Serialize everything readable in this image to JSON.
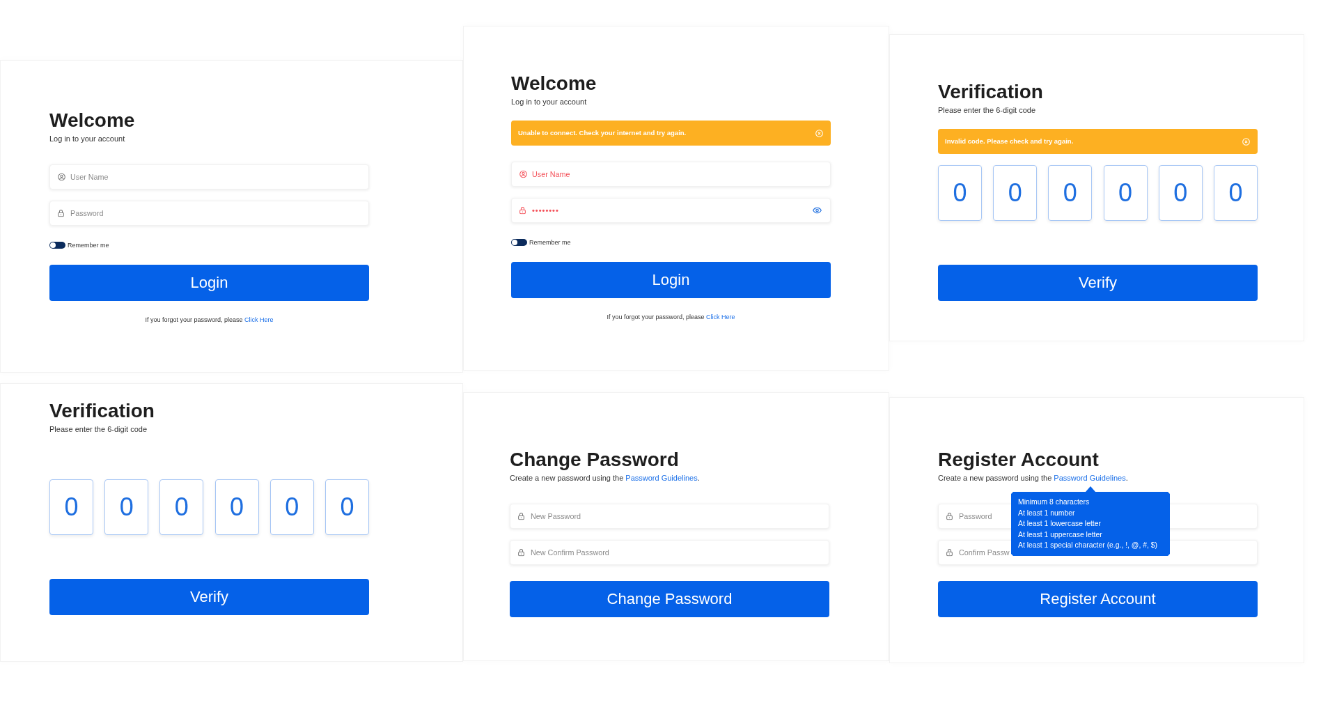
{
  "screens": [
    {
      "title": "Welcome",
      "subtitle": {
        "text": "Log in to your account"
      },
      "fields": [
        {
          "kind": "username",
          "placeholder": "User Name",
          "error": false
        },
        {
          "kind": "password",
          "placeholder": "Password",
          "error": false
        }
      ],
      "remember": {
        "label": "Remember me",
        "checked": false
      },
      "button": "Login",
      "footer": {
        "text": "If you forgot your password, please",
        "link": "Click Here"
      }
    },
    {
      "title": "Welcome",
      "subtitle": {
        "text": "Log in to your account"
      },
      "alert": "Unable to connect. Check your internet and try again.",
      "fields": [
        {
          "kind": "username",
          "placeholder": "User Name",
          "error": true
        },
        {
          "kind": "password",
          "value": "••••••••",
          "error": true
        }
      ],
      "remember": {
        "label": "Remember me",
        "checked": false
      },
      "button": "Login",
      "footer": {
        "text": "If you forgot your password, please",
        "link": "Click Here"
      }
    },
    {
      "title": "Verification",
      "subtitle": {
        "text": "Please enter the 6-digit code"
      },
      "alert": "Invalid code. Please check and try again.",
      "code": [
        "0",
        "0",
        "0",
        "0",
        "0",
        "0"
      ],
      "button": "Verify"
    },
    {
      "title": "Verification",
      "subtitle": {
        "text": "Please enter the 6-digit code"
      },
      "code": [
        "0",
        "0",
        "0",
        "0",
        "0",
        "0"
      ],
      "button": "Verify"
    },
    {
      "title": "Change Password",
      "subtitle": {
        "text": "Create a new password using the",
        "link": "Password Guidelines",
        "after": "."
      },
      "fields": [
        {
          "kind": "password",
          "placeholder": "New Password",
          "error": false
        },
        {
          "kind": "password",
          "placeholder": "New Confirm Password",
          "error": false
        }
      ],
      "button": "Change Password"
    },
    {
      "title": "Register Account",
      "subtitle": {
        "text": "Create a new password using the",
        "link": "Password Guidelines",
        "after": "."
      },
      "fields": [
        {
          "kind": "password",
          "placeholder": "Password",
          "error": false
        },
        {
          "kind": "password",
          "placeholder": "Confirm Passw",
          "error": false
        }
      ],
      "tooltip": [
        "Minimum 8 characters",
        "At least 1 number",
        "At least 1 lowercase letter",
        "At least 1 uppercase letter",
        "At least 1 special character (e.g., !, @, #, $)"
      ],
      "button": "Register Account"
    }
  ]
}
